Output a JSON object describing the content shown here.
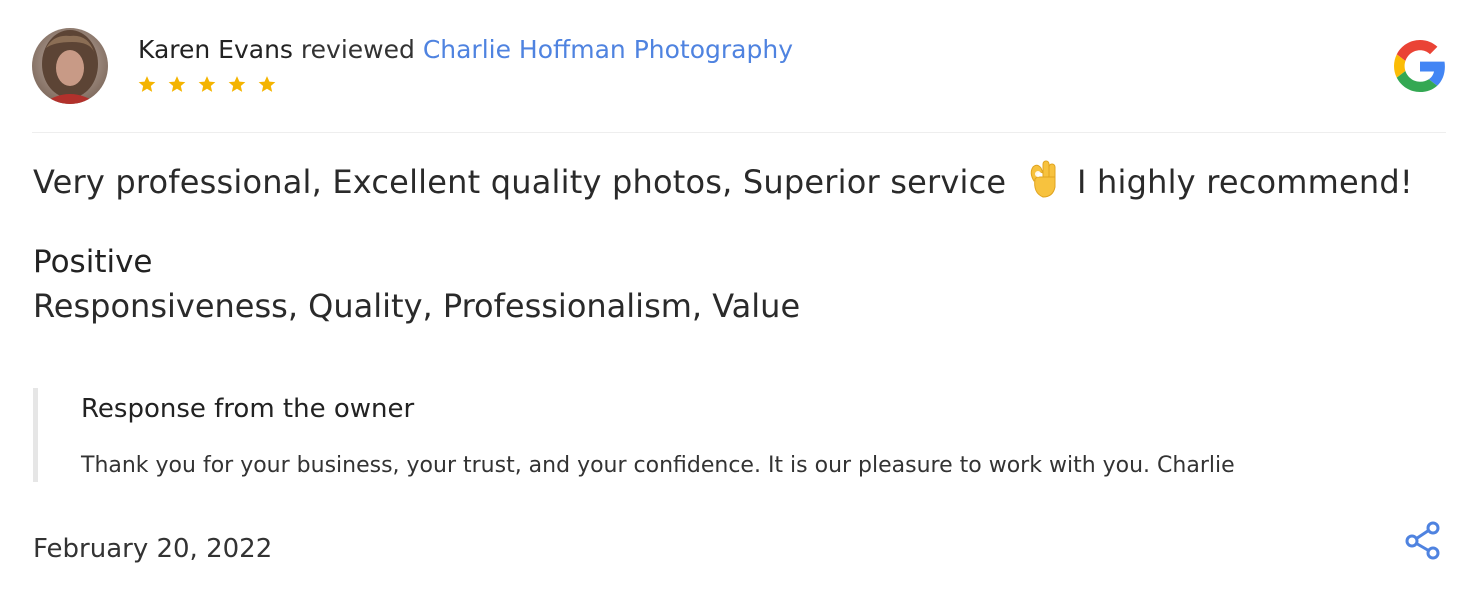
{
  "review": {
    "reviewer_name": "Karen Evans",
    "reviewed_word": "reviewed",
    "business_name": "Charlie Hoffman Photography",
    "rating": 5,
    "rating_max": 5,
    "text_before_emoji": "Very professional, Excellent quality photos, Superior service",
    "emoji_icon": "ok-hand-emoji",
    "text_after_emoji": "I highly recommend!",
    "positive_title": "Positive",
    "positive_list": "Responsiveness, Quality, Professionalism, Value",
    "date": "February 20, 2022"
  },
  "owner_response": {
    "title": "Response from the owner",
    "text": "Thank you for your business, your trust, and your confidence. It is our pleasure to work with you. Charlie"
  },
  "icons": {
    "brand": "google-icon",
    "share": "share-icon",
    "star": "star-icon"
  },
  "colors": {
    "link": "#4f83e0",
    "star": "#f4b400",
    "share": "#4f83e0",
    "divider": "#eeeeee",
    "response_border": "#e6e6e6"
  }
}
